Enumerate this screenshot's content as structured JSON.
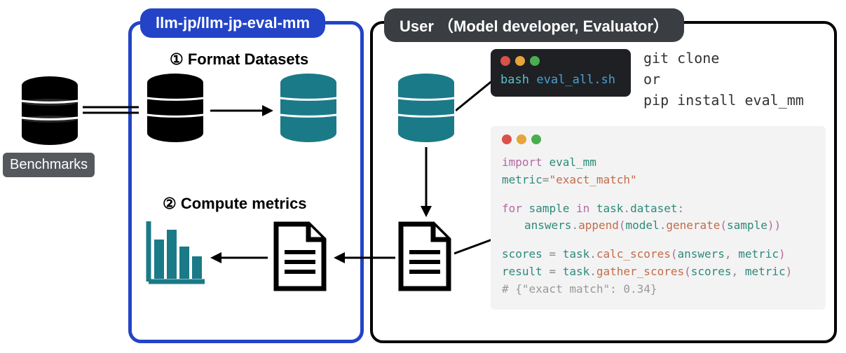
{
  "pills": {
    "library": "llm-jp/llm-jp-eval-mm",
    "user": "User （Model developer, Evaluator）",
    "benchmarks": "Benchmarks"
  },
  "steps": {
    "format": "① Format Datasets",
    "compute": "② Compute metrics"
  },
  "install": {
    "line1": "git clone",
    "line2": "or",
    "line3": "pip install eval_mm"
  },
  "terminal": {
    "cmd1": "bash",
    "cmd2": "eval_all.sh"
  },
  "code": {
    "l1a": "import",
    "l1b": "eval_mm",
    "l2a": "metric",
    "l2b": "=",
    "l2c": "\"exact_match\"",
    "l3a": "for",
    "l3b": "sample",
    "l3c": "in",
    "l3d": "task",
    "l3e": ".",
    "l3f": "dataset",
    "l3g": ":",
    "l4a": "answers",
    "l4b": ".",
    "l4c": "append",
    "l4d": "(",
    "l4e": "model",
    "l4f": ".",
    "l4g": "generate",
    "l4h": "(",
    "l4i": "sample",
    "l4j": ")",
    "l4k": ")",
    "l5a": "scores",
    "l5b": " = ",
    "l5c": "task",
    "l5d": ".",
    "l5e": "calc_scores",
    "l5f": "(",
    "l5g": "answers",
    "l5h": ", ",
    "l5i": "metric",
    "l5j": ")",
    "l6a": "result",
    "l6b": " = ",
    "l6c": "task",
    "l6d": ".",
    "l6e": "gather_scores",
    "l6f": "(",
    "l6g": "scores",
    "l6h": ", ",
    "l6i": "metric",
    "l6j": ")",
    "l7": "# {\"exact match\": 0.34}"
  }
}
